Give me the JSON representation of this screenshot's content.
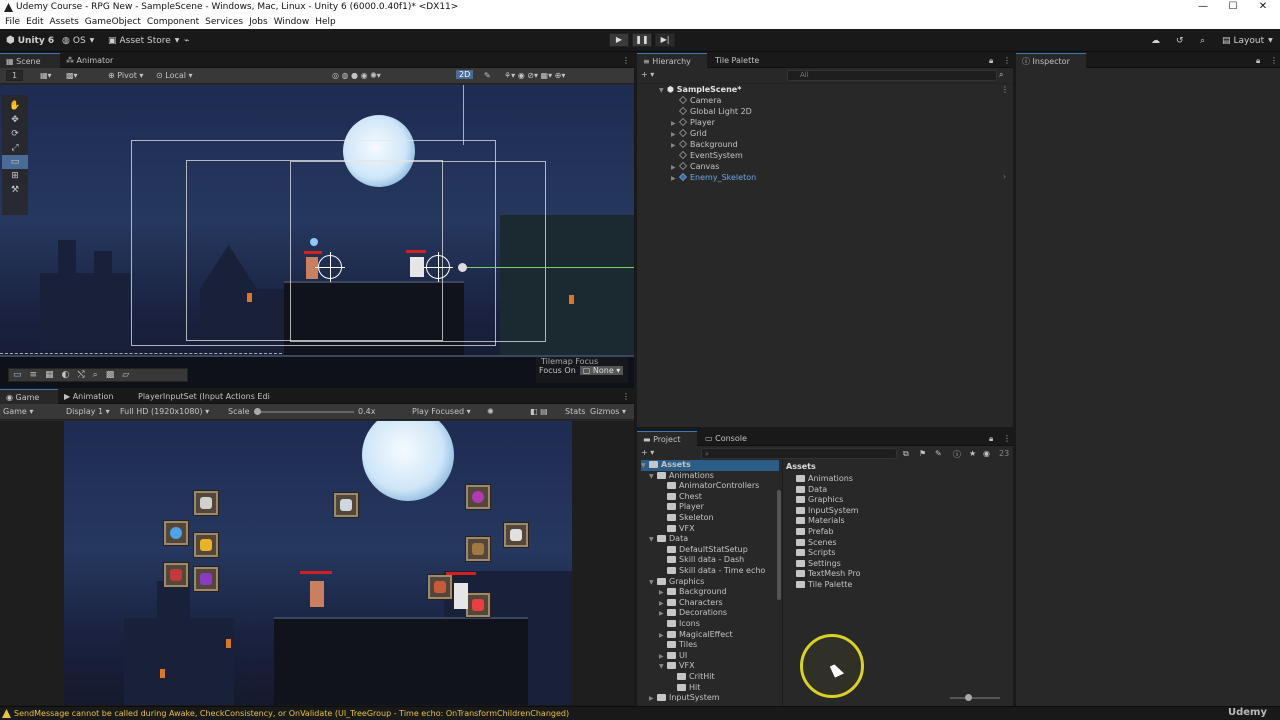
{
  "window": {
    "title": "Udemy Course - RPG New - SampleScene - Windows, Mac, Linux - Unity 6 (6000.0.40f1)* <DX11>",
    "minimize": "—",
    "maximize": "☐",
    "close": "✕"
  },
  "menu": [
    "File",
    "Edit",
    "Assets",
    "GameObject",
    "Component",
    "Services",
    "Jobs",
    "Window",
    "Help"
  ],
  "toolbar": {
    "unity_label": "Unity 6",
    "os_label": "OS",
    "asset_store_label": "Asset Store",
    "play": "▶",
    "pause": "❚❚",
    "step": "▶|",
    "layout_label": "Layout"
  },
  "scene_panel": {
    "tabs": [
      "Scene",
      "Animator"
    ],
    "layer_value": "1",
    "pivot_label": "Pivot",
    "local_label": "Local",
    "mode_2d": "2D",
    "tilemap_focus_label": "Tilemap Focus",
    "focus_on_label": "Focus On",
    "focus_value": "None"
  },
  "game_panel": {
    "tabs": [
      "Game",
      "Animation"
    ],
    "input_set_label": "PlayerInputSet (Input Actions Edi",
    "game_label": "Game",
    "display_label": "Display 1",
    "resolution_label": "Full HD (1920x1080)",
    "scale_label": "Scale",
    "scale_value": "0.4x",
    "play_focused_label": "Play Focused",
    "stats_label": "Stats",
    "gizmos_label": "Gizmos"
  },
  "hierarchy": {
    "tabs": [
      "Hierarchy",
      "Tile Palette"
    ],
    "search_placeholder": "All",
    "scene_name": "SampleScene*",
    "items": [
      "Camera",
      "Global Light 2D",
      "Player",
      "Grid",
      "Background",
      "EventSystem",
      "Canvas",
      "Enemy_Skeleton"
    ]
  },
  "inspector": {
    "tab": "Inspector"
  },
  "project": {
    "tabs": [
      "Project",
      "Console"
    ],
    "count_badge": "23",
    "breadcrumb": "Assets",
    "tree": [
      {
        "label": "Assets",
        "depth": 0,
        "open": true
      },
      {
        "label": "Animations",
        "depth": 1,
        "open": true
      },
      {
        "label": "AnimatorControllers",
        "depth": 2
      },
      {
        "label": "Chest",
        "depth": 2
      },
      {
        "label": "Player",
        "depth": 2
      },
      {
        "label": "Skeleton",
        "depth": 2
      },
      {
        "label": "VFX",
        "depth": 2
      },
      {
        "label": "Data",
        "depth": 1,
        "open": true
      },
      {
        "label": "DefaultStatSetup",
        "depth": 2
      },
      {
        "label": "Skill data - Dash",
        "depth": 2
      },
      {
        "label": "Skill data - Time echo",
        "depth": 2
      },
      {
        "label": "Graphics",
        "depth": 1,
        "open": true
      },
      {
        "label": "Background",
        "depth": 2
      },
      {
        "label": "Characters",
        "depth": 2
      },
      {
        "label": "Decorations",
        "depth": 2
      },
      {
        "label": "Icons",
        "depth": 2
      },
      {
        "label": "MagicalEffect",
        "depth": 2
      },
      {
        "label": "Tiles",
        "depth": 2
      },
      {
        "label": "UI",
        "depth": 2
      },
      {
        "label": "VFX",
        "depth": 2,
        "open": true
      },
      {
        "label": "CritHit",
        "depth": 3
      },
      {
        "label": "Hit",
        "depth": 3
      },
      {
        "label": "InputSystem",
        "depth": 1
      }
    ],
    "assets": [
      "Animations",
      "Data",
      "Graphics",
      "InputSystem",
      "Materials",
      "Prefab",
      "Scenes",
      "Scripts",
      "Settings",
      "TextMesh Pro",
      "Tile Palette"
    ]
  },
  "status": {
    "message": "SendMessage cannot be called during Awake, CheckConsistency, or OnValidate (UI_TreeGroup - Time echo: OnTransformChildrenChanged)",
    "warning_color": "#e8c247"
  },
  "watermark": "Udemy"
}
